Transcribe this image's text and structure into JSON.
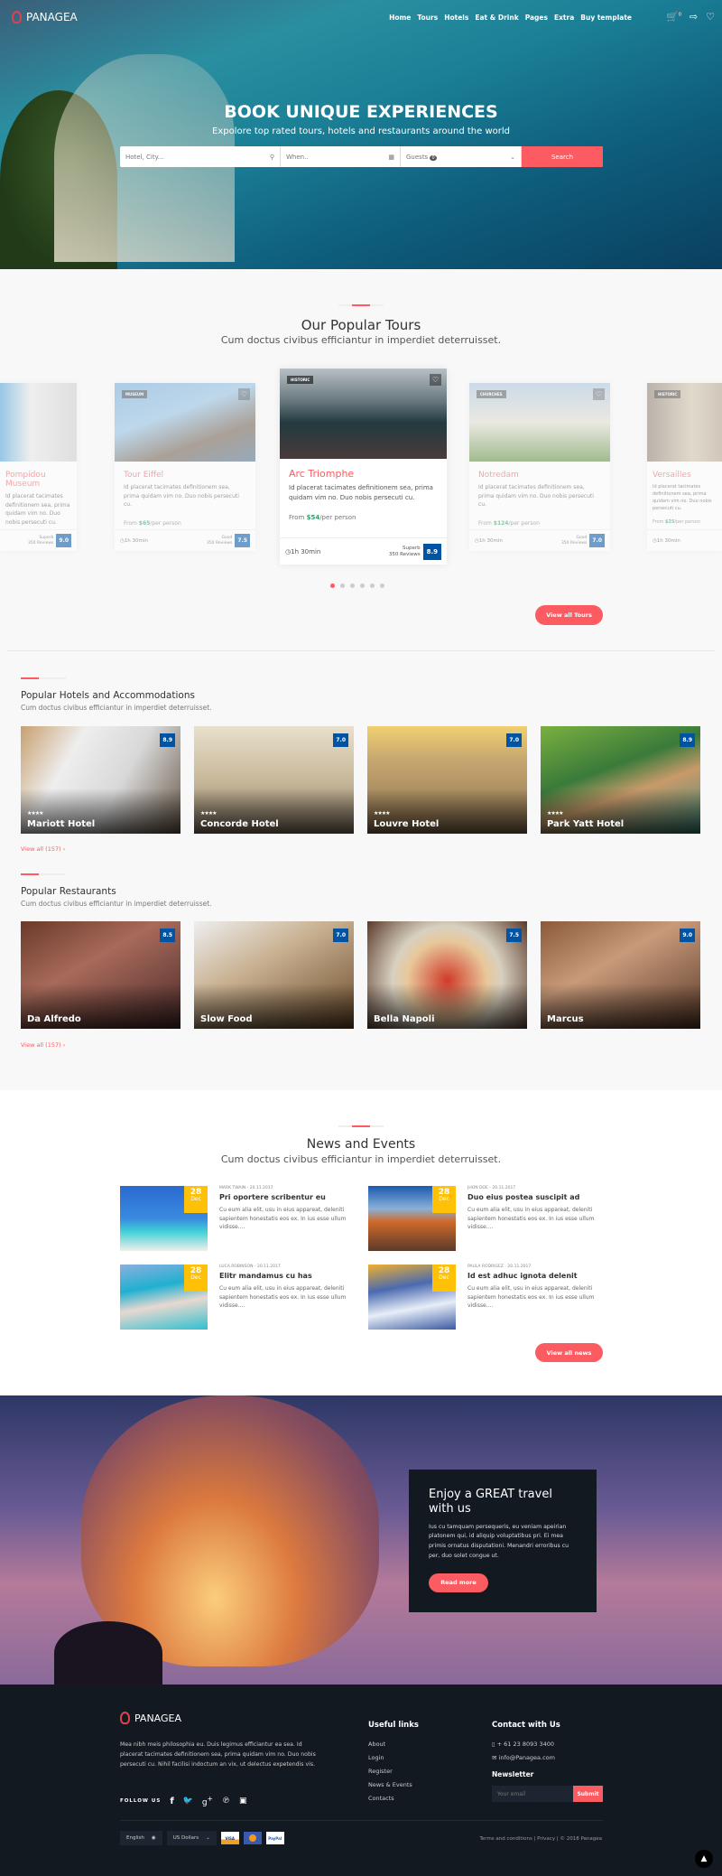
{
  "header": {
    "brand": "PANAGEA",
    "nav": [
      "Home",
      "Tours",
      "Hotels",
      "Eat & Drink",
      "Pages",
      "Extra",
      "Buy template"
    ],
    "icons": [
      "cart-icon",
      "login-icon",
      "heart-icon"
    ],
    "cart_count": "0"
  },
  "hero": {
    "title": "BOOK UNIQUE EXPERIENCES",
    "subtitle": "Expolore top rated tours, hotels and restaurants around the world",
    "search": {
      "location_placeholder": "Hotel, City...",
      "date_placeholder": "When..",
      "guests_label": "Guests",
      "guests_count": "0",
      "button": "Search"
    }
  },
  "tours": {
    "title": "Our Popular Tours",
    "subtitle": "Cum doctus civibus efficiantur in imperdiet deterruisset.",
    "view_all": "View all Tours",
    "active_slide": 0,
    "slide_count": 6,
    "items": [
      {
        "badge": "",
        "name": "Pompidou Museum",
        "desc": "Id placerat tacimates definitionem sea, prima quidam vim no. Duo nobis persecuti cu.",
        "price": "",
        "duration": "",
        "rating_label": "Superb",
        "reviews": "350 Reviews",
        "score": "9.0"
      },
      {
        "badge": "MUSEUM",
        "name": "Tour Eiffel",
        "desc": "Id placerat tacimates definitionem sea, prima quidam vim no. Duo nobis persecuti cu.",
        "price_prefix": "From ",
        "price": "$65",
        "price_suffix": "/per person",
        "duration": "1h 30min",
        "rating_label": "Good",
        "reviews": "350 Reviews",
        "score": "7.5"
      },
      {
        "badge": "HISTORIC",
        "name": "Arc Triomphe",
        "desc": "Id placerat tacimates definitionem sea, prima quidam vim no. Duo nobis persecuti cu.",
        "price_prefix": "From ",
        "price": "$54",
        "price_suffix": "/per person",
        "duration": "1h 30min",
        "rating_label": "Superb",
        "reviews": "350 Reviews",
        "score": "8.9"
      },
      {
        "badge": "CHURCHES",
        "name": "Notredam",
        "desc": "Id placerat tacimates definitionem sea, prima quidam vim no. Duo nobis persecuti cu.",
        "price_prefix": "From ",
        "price": "$124",
        "price_suffix": "/per person",
        "duration": "1h 30min",
        "rating_label": "Good",
        "reviews": "350 Reviews",
        "score": "7.0"
      },
      {
        "badge": "HISTORIC",
        "name": "Versailles",
        "desc": "Id placerat tacimates definitionem sea, prima quidam vim no. Duo nobis persecuti cu.",
        "price_prefix": "From ",
        "price": "$25",
        "price_suffix": "/per person",
        "duration": "1h 30min"
      }
    ]
  },
  "hotels": {
    "title": "Popular Hotels and Accommodations",
    "subtitle": "Cum doctus civibus efficiantur in imperdiet deterruisset.",
    "view_all": "View all (157)",
    "items": [
      {
        "name": "Mariott Hotel",
        "score": "8.9",
        "stars": "★★★★"
      },
      {
        "name": "Concorde Hotel",
        "score": "7.0",
        "stars": "★★★★"
      },
      {
        "name": "Louvre Hotel",
        "score": "7.0",
        "stars": "★★★★"
      },
      {
        "name": "Park Yatt Hotel",
        "score": "8.9",
        "stars": "★★★★"
      }
    ]
  },
  "restaurants": {
    "title": "Popular Restaurants",
    "subtitle": "Cum doctus civibus efficiantur in imperdiet deterruisset.",
    "view_all": "View all (157)",
    "items": [
      {
        "name": "Da Alfredo",
        "score": "8.5"
      },
      {
        "name": "Slow Food",
        "score": "7.0"
      },
      {
        "name": "Bella Napoli",
        "score": "7.5"
      },
      {
        "name": "Marcus",
        "score": "9.0"
      }
    ]
  },
  "news": {
    "title": "News and Events",
    "subtitle": "Cum doctus civibus efficiantur in imperdiet deterruisset.",
    "view_all": "View all news",
    "items": [
      {
        "day": "28",
        "month": "Dec",
        "author": "MARK TWAIN",
        "date": "20.11.2017",
        "title": "Pri oportere scribentur eu",
        "desc": "Cu eum alia elit, usu in eius appareat, deleniti sapientem honestatis eos ex. In ius esse ullum vidisse...."
      },
      {
        "day": "28",
        "month": "Dec",
        "author": "JHON DOE",
        "date": "20.11.2017",
        "title": "Duo eius postea suscipit ad",
        "desc": "Cu eum alia elit, usu in eius appareat, deleniti sapientem honestatis eos ex. In ius esse ullum vidisse...."
      },
      {
        "day": "28",
        "month": "Dec",
        "author": "LUCA ROBINSON",
        "date": "20.11.2017",
        "title": "Elitr mandamus cu has",
        "desc": "Cu eum alia elit, usu in eius appareat, deleniti sapientem honestatis eos ex. In ius esse ullum vidisse...."
      },
      {
        "day": "28",
        "month": "Dec",
        "author": "PAULA RODRIGEZ",
        "date": "20.11.2017",
        "title": "Id est adhuc ignota delenit",
        "desc": "Cu eum alia elit, usu in eius appareat, deleniti sapientem honestatis eos ex. In ius esse ullum vidisse...."
      }
    ]
  },
  "promo": {
    "title": "Enjoy a GREAT travel with us",
    "text": "Ius cu tamquam persequeris, eu veniam apeirian platonem qui, id aliquip voluptatibus pri. Ei mea primis ornatus disputationi. Menandri erroribus cu per, duo solet congue ut.",
    "button": "Read more"
  },
  "footer": {
    "brand": "PANAGEA",
    "about": "Mea nibh meis philosophia eu. Duis legimus efficiantur ea sea. Id placerat tacimates definitionem sea, prima quidam vim no. Duo nobis persecuti cu. Nihil facilisi indoctum an vix, ut delectus expetendis vis.",
    "follow_label": "FOLLOW US",
    "social": [
      "facebook-icon",
      "twitter-icon",
      "google-plus-icon",
      "pinterest-icon",
      "instagram-icon"
    ],
    "links_title": "Useful links",
    "links": [
      "About",
      "Login",
      "Register",
      "News & Events",
      "Contacts"
    ],
    "contact_title": "Contact with Us",
    "phone": "+ 61 23 8093 3400",
    "email": "info@Panagea.com",
    "newsletter_title": "Newsletter",
    "newsletter_placeholder": "Your email",
    "newsletter_button": "Submit",
    "language": "English",
    "currency": "US Dollars",
    "payments": [
      "VISA",
      "MC",
      "PayPal"
    ],
    "terms": "Terms and conditions",
    "privacy": "Privacy",
    "copyright": "© 2018 Panagea"
  },
  "colors": {
    "accent": "#fc5b62",
    "score": "#0054a6",
    "date_badge": "#ffc107",
    "price": "#32a067",
    "footer_bg": "#121921"
  }
}
